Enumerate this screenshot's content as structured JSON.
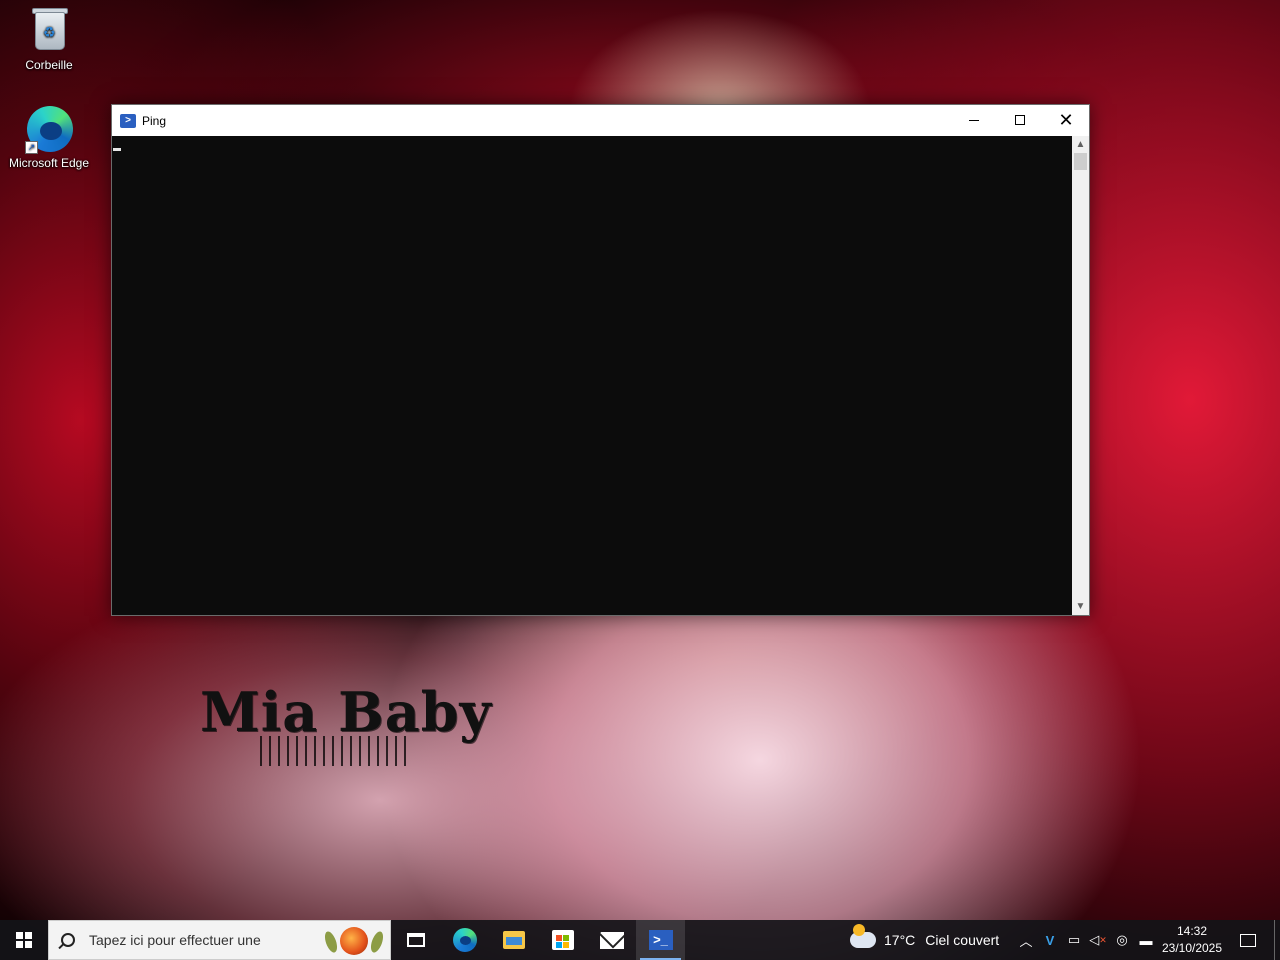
{
  "desktop": {
    "icons": [
      {
        "label": "Corbeille"
      },
      {
        "label": "Microsoft Edge"
      }
    ],
    "wallpaper_text": "Mia Baby"
  },
  "window": {
    "title": "Ping",
    "minimize_symbol": "—",
    "close_symbol": "✕",
    "console_text": ""
  },
  "taskbar": {
    "search_placeholder": "Tapez ici pour effectuer une",
    "pinned": [
      "task-view",
      "microsoft-edge",
      "file-explorer",
      "microsoft-store",
      "mail",
      "powershell"
    ],
    "active_app": "powershell",
    "weather": {
      "temperature": "17°C",
      "condition": "Ciel couvert"
    },
    "tray_chevron": "^",
    "clock": {
      "time": "14:32",
      "date": "23/10/2025"
    }
  },
  "colors": {
    "console_bg": "#0c0c0c",
    "taskbar_bg": "#141418",
    "accent": "#7db3f0"
  }
}
